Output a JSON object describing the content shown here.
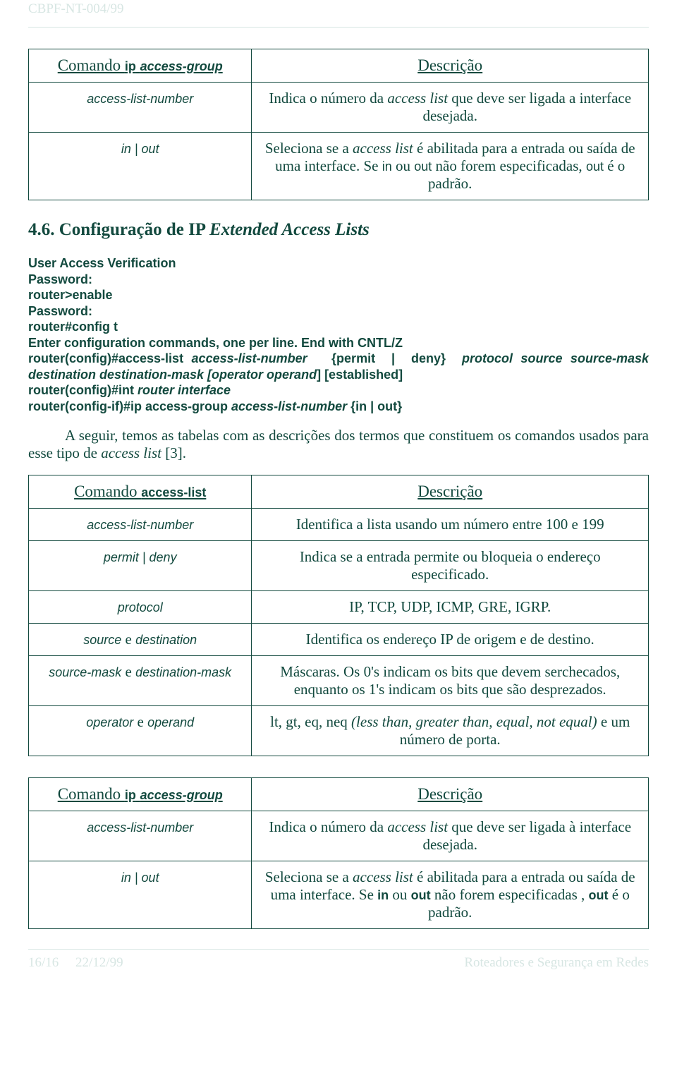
{
  "header": {
    "doc_id": "CBPF-NT-004/99"
  },
  "table1": {
    "h1": "Comando ip access-group",
    "h2": "Descrição",
    "rows": [
      {
        "left": "access-list-number",
        "right_parts": [
          {
            "t": "Indica o número da "
          },
          {
            "t": "access list",
            "i": true
          },
          {
            "t": " que deve ser ligada a interface desejada."
          }
        ]
      },
      {
        "left": "in | out",
        "right_parts": [
          {
            "t": "Seleciona se a "
          },
          {
            "t": "access list",
            "i": true
          },
          {
            "t": " é abilitada para a entrada ou saída de uma interface. Se "
          },
          {
            "t": "in",
            "m": true
          },
          {
            "t": " ou "
          },
          {
            "t": "out",
            "m": true
          },
          {
            "t": " não forem especificadas, "
          },
          {
            "t": "out",
            "m": true
          },
          {
            "t": " é o padrão."
          }
        ]
      }
    ]
  },
  "section_title_parts": [
    {
      "t": "4.6. Configuração de IP "
    },
    {
      "t": "Extended Access Lists",
      "i": true
    }
  ],
  "code": {
    "l1": "User Access Verification",
    "l2": "Password:",
    "l3": "router>enable",
    "l4": "Password:",
    "l5": "router#config t",
    "l6": "Enter configuration commands, one per line. End with CNTL/Z",
    "l7": {
      "pre": "router(config)#access-list ",
      "aln": "access-list-number",
      "mid": " {permit | deny} ",
      "proto": "protocol source source-mask destination destination-mask",
      "op": " [operator operand]",
      "est": " [established]"
    },
    "l8": {
      "pre": "router(config)#int ",
      "ri": "router interface"
    },
    "l9": {
      "pre": "router(config-if)#ip access-group ",
      "aln": "access-list-number",
      "tail": " {in | out}"
    }
  },
  "paragraph_parts": [
    {
      "t": "A seguir, temos as tabelas com as descrições dos termos que constituem os comandos usados para esse tipo de "
    },
    {
      "t": "access list",
      "i": true
    },
    {
      "t": " [3]."
    }
  ],
  "table2": {
    "h1": "Comando access-list",
    "h2": "Descrição",
    "rows": [
      {
        "left": "access-list-number",
        "right_parts": [
          {
            "t": "Identifica a lista usando um número entre 100 e 199"
          }
        ]
      },
      {
        "left": "permit | deny",
        "right_parts": [
          {
            "t": "Indica se a entrada permite ou bloqueia o endereço especificado."
          }
        ]
      },
      {
        "left": "protocol",
        "right_parts": [
          {
            "t": "IP, TCP, UDP, ICMP, GRE, IGRP."
          }
        ]
      },
      {
        "left_parts": [
          {
            "t": "source",
            "i": true
          },
          {
            "t": " e ",
            "plain": true
          },
          {
            "t": "destination",
            "i": true
          }
        ],
        "right_parts": [
          {
            "t": "Identifica os endereço IP de origem e de destino."
          }
        ]
      },
      {
        "left_parts": [
          {
            "t": "source-mask",
            "i": true
          },
          {
            "t": " e ",
            "plain": true
          },
          {
            "t": "destination-mask",
            "i": true
          }
        ],
        "right_parts": [
          {
            "t": "Máscaras. Os 0's indicam os bits que devem serchecados, enquanto os 1's indicam os bits que são desprezados."
          }
        ]
      },
      {
        "left_parts": [
          {
            "t": "operator",
            "i": true
          },
          {
            "t": " e ",
            "plain": true
          },
          {
            "t": "operand",
            "i": true
          }
        ],
        "right_parts": [
          {
            "t": "lt, gt, eq, neq "
          },
          {
            "t": "(less than, greater than, equal, not equal)",
            "i": true
          },
          {
            "t": " e um número de porta."
          }
        ]
      }
    ]
  },
  "table3": {
    "h1": "Comando ip access-group",
    "h2": "Descrição",
    "rows": [
      {
        "left": "access-list-number",
        "right_parts": [
          {
            "t": "Indica o número da "
          },
          {
            "t": "access list",
            "i": true
          },
          {
            "t": " que deve ser ligada à interface desejada."
          }
        ]
      },
      {
        "left": "in | out",
        "right_parts": [
          {
            "t": "Seleciona se a "
          },
          {
            "t": "access list",
            "i": true
          },
          {
            "t": " é abilitada para a entrada ou saída de uma interface. Se "
          },
          {
            "t": "in",
            "m": true,
            "b": true
          },
          {
            "t": " ou "
          },
          {
            "t": "out",
            "m": true,
            "b": true
          },
          {
            "t": " não forem especificadas , "
          },
          {
            "t": "out",
            "m": true,
            "b": true
          },
          {
            "t": " é o padrão."
          }
        ]
      }
    ]
  },
  "footer": {
    "left_page": "16/16",
    "left_date": "22/12/99",
    "right": "Roteadores e Segurança em Redes"
  }
}
